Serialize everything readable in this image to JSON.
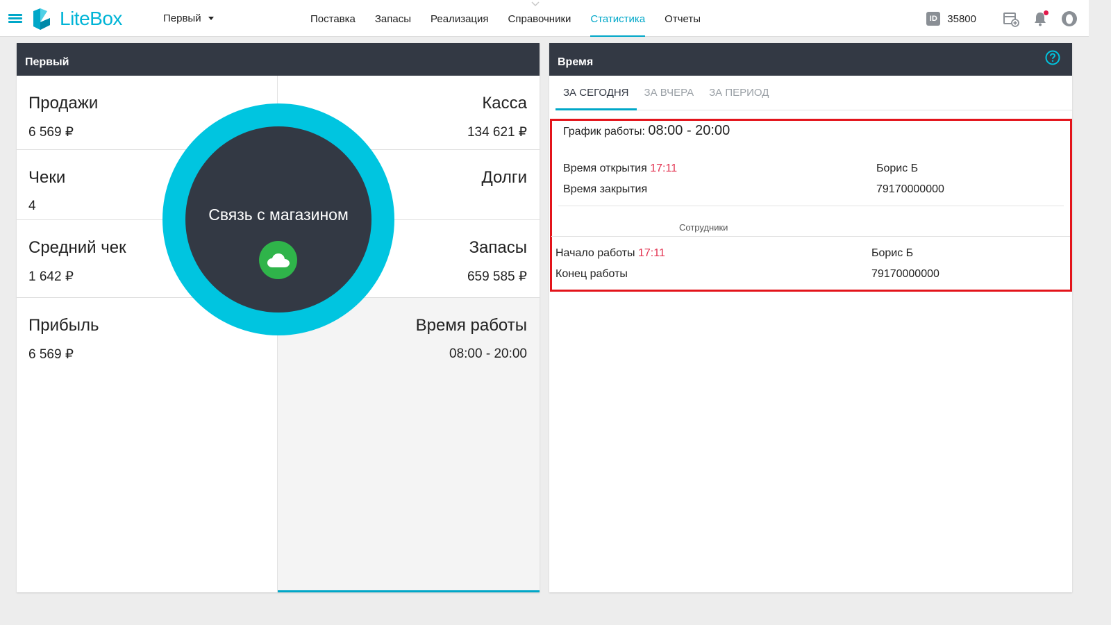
{
  "app": {
    "logo_text": "LiteBox",
    "store_name": "Первый",
    "nav": [
      "Поставка",
      "Запасы",
      "Реализация",
      "Справочники",
      "Статистика",
      "Отчеты"
    ],
    "nav_active": "Статистика",
    "id_label": "ID",
    "id_value": "35800",
    "accent_color": "#00a7c8"
  },
  "left_panel": {
    "title": "Первый",
    "stats_left": [
      {
        "label": "Продажи",
        "value": "6 569 ₽"
      },
      {
        "label": "Чеки",
        "value": "4"
      },
      {
        "label": "Средний чек",
        "value": "1 642 ₽"
      },
      {
        "label": "Прибыль",
        "value": "6 569 ₽"
      }
    ],
    "stats_right": [
      {
        "label": "Касса",
        "value": "134 621 ₽"
      },
      {
        "label": "Долги",
        "value": ""
      },
      {
        "label": "Запасы",
        "value": "659 585 ₽"
      },
      {
        "label": "Время работы",
        "value": "08:00 - 20:00"
      }
    ],
    "connection_overlay": {
      "text": "Связь с магазином",
      "icon": "cloud-icon",
      "status_color": "#2fb44a"
    }
  },
  "right_panel": {
    "title": "Время",
    "tabs": [
      "ЗА СЕГОДНЯ",
      "ЗА ВЧЕРА",
      "ЗА ПЕРИОД"
    ],
    "active_tab": "ЗА СЕГОДНЯ",
    "schedule_label": "График работы:",
    "schedule_value": "08:00 - 20:00",
    "open_label": "Время открытия",
    "open_time": "17:11",
    "close_label": "Время закрытия",
    "open_employee": "Борис Б",
    "open_phone": "79170000000",
    "employees_caption": "Сотрудники",
    "start_label": "Начало работы",
    "start_time": "17:11",
    "end_label": "Конец работы",
    "emp_name": "Борис Б",
    "emp_phone": "79170000000"
  }
}
